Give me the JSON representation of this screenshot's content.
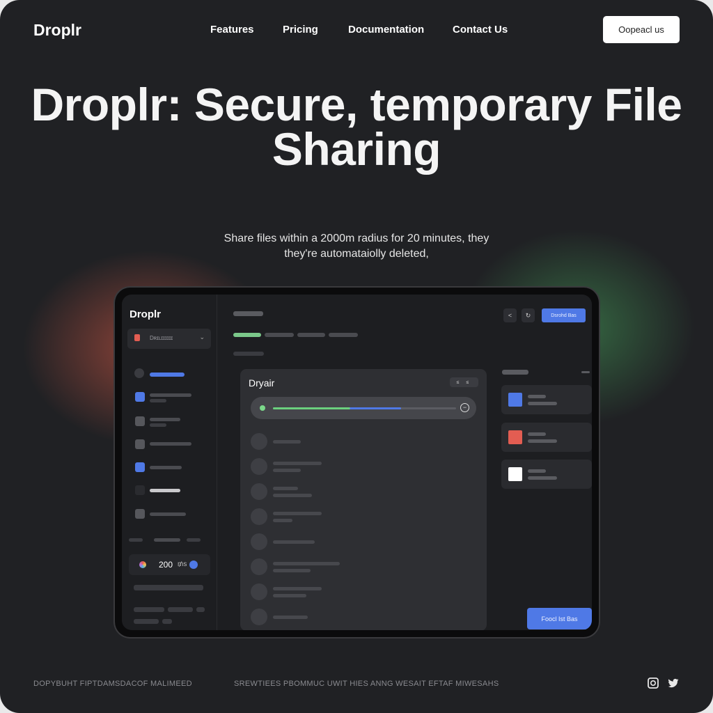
{
  "brand": "Droplr",
  "nav": {
    "links": [
      "Features",
      "Pricing",
      "Documentation",
      "Contact Us"
    ],
    "cta": "Oopeacl us"
  },
  "hero": {
    "title": "Droplr: Secure, temporary File Sharing",
    "subtitle": "Share files within a 2000m radius for 20 minutes, they they're automataiolly deleted,"
  },
  "app": {
    "logo": "Droplr",
    "workspace_label": "Dʀɪʟɪɪɪɪɪɪ",
    "upload_button": "Dsrohd Bas",
    "card_title": "Dryair",
    "card_toggle": "≤ ≤",
    "credits": {
      "value": "200",
      "unit": "₥s"
    },
    "upload_progress": 0.7,
    "bottom_button": "Foocl Ist Bas",
    "panel_colors": [
      "#4f79e6",
      "#e35d52",
      "#ffffff"
    ]
  },
  "footer": {
    "copyright": "DOPYBUHT FIPTDAMSDACOF MALIMEED",
    "tagline": "SREWTIEES PBOMMUC UWIT HIES ANNG WESAIT EFTAF MIWESAHS"
  },
  "icons": [
    "chevron-down-icon",
    "share-icon",
    "refresh-icon",
    "instagram-icon",
    "twitter-icon"
  ]
}
